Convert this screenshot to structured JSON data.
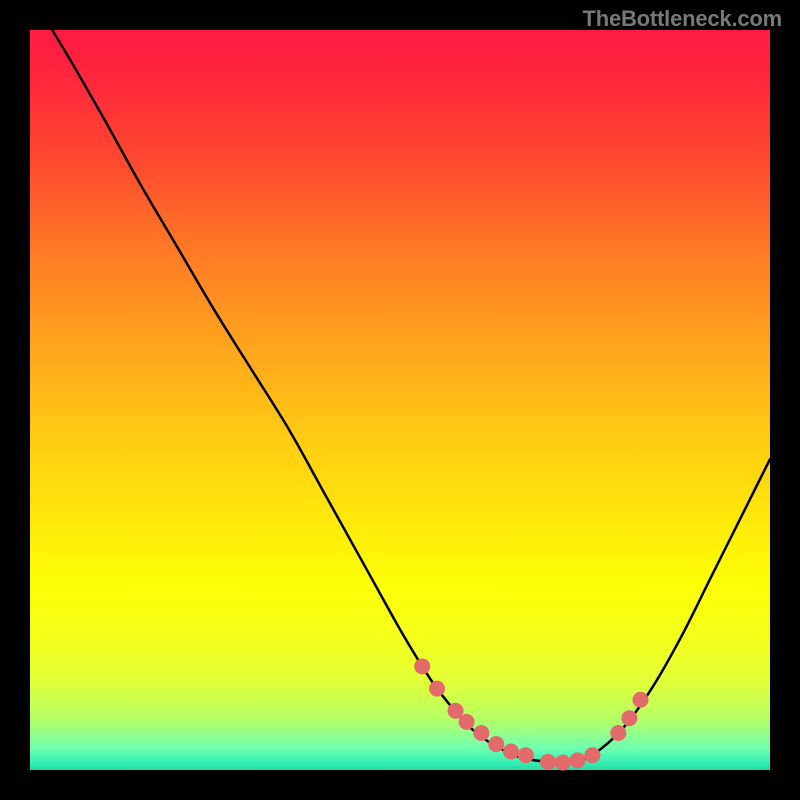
{
  "watermark": "TheBottleneck.com",
  "chart_data": {
    "type": "line",
    "title": "",
    "xlabel": "",
    "ylabel": "",
    "xlim": [
      0,
      100
    ],
    "ylim": [
      0,
      100
    ],
    "grid": false,
    "series": [
      {
        "name": "curve",
        "color": "#000000",
        "x": [
          3,
          6,
          10,
          15,
          20,
          25,
          30,
          35,
          40,
          45,
          50,
          53,
          55,
          57,
          59,
          61,
          63,
          65,
          67,
          70,
          72,
          74,
          76,
          80,
          84,
          88,
          92,
          96,
          100
        ],
        "y": [
          100,
          95,
          88,
          79,
          70.5,
          62,
          54,
          46,
          37,
          28,
          19,
          14,
          11,
          8.5,
          6.2,
          4.5,
          3.2,
          2.2,
          1.5,
          1.1,
          1.0,
          1.3,
          2.0,
          5.5,
          11,
          18,
          26,
          34,
          42
        ]
      }
    ],
    "markers": [
      {
        "name": "dots",
        "color": "#e26a6a",
        "radius_px": 8,
        "x": [
          53,
          55,
          57.5,
          59,
          61,
          63,
          65,
          67,
          70,
          72,
          74,
          76,
          79.5,
          81,
          82.5
        ],
        "y": [
          14,
          11,
          8,
          6.5,
          5,
          3.5,
          2.5,
          2,
          1.1,
          1.0,
          1.3,
          2.0,
          5,
          7,
          9.5
        ]
      }
    ]
  }
}
